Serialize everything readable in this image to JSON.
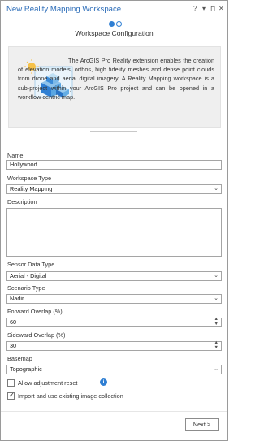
{
  "window": {
    "title": "New Reality Mapping Workspace",
    "help_label": "?",
    "pin_label": "▾",
    "dock_label": "⊓",
    "close_label": "✕"
  },
  "wizard": {
    "step_title": "Workspace Configuration",
    "description": "The ArcGIS Pro Reality extension enables the creation of elevation models, orthos, high fidelity meshes and dense point clouds from drone and aerial digital imagery. A Reality Mapping workspace is a sub-project within your ArcGIS Pro project and can be opened in a workflow centric map."
  },
  "form": {
    "name_label": "Name",
    "name_value": "Hollywood",
    "workspace_type_label": "Workspace Type",
    "workspace_type_value": "Reality Mapping",
    "description_label": "Description",
    "description_value": "",
    "sensor_label": "Sensor Data Type",
    "sensor_value": "Aerial - Digital",
    "scenario_label": "Scenario Type",
    "scenario_value": "Nadir",
    "forward_overlap_label": "Forward Overlap (%)",
    "forward_overlap_value": "60",
    "sideward_overlap_label": "Sideward Overlap (%)",
    "sideward_overlap_value": "30",
    "basemap_label": "Basemap",
    "basemap_value": "Topographic",
    "adjustment_reset_label": "Allow adjustment reset",
    "adjustment_reset_checked": false,
    "import_collection_label": "Import and use existing image collection",
    "import_collection_checked": true
  },
  "footer": {
    "next_label": "Next >"
  },
  "colors": {
    "accent": "#2f7fd3",
    "title": "#2b6cb8"
  }
}
